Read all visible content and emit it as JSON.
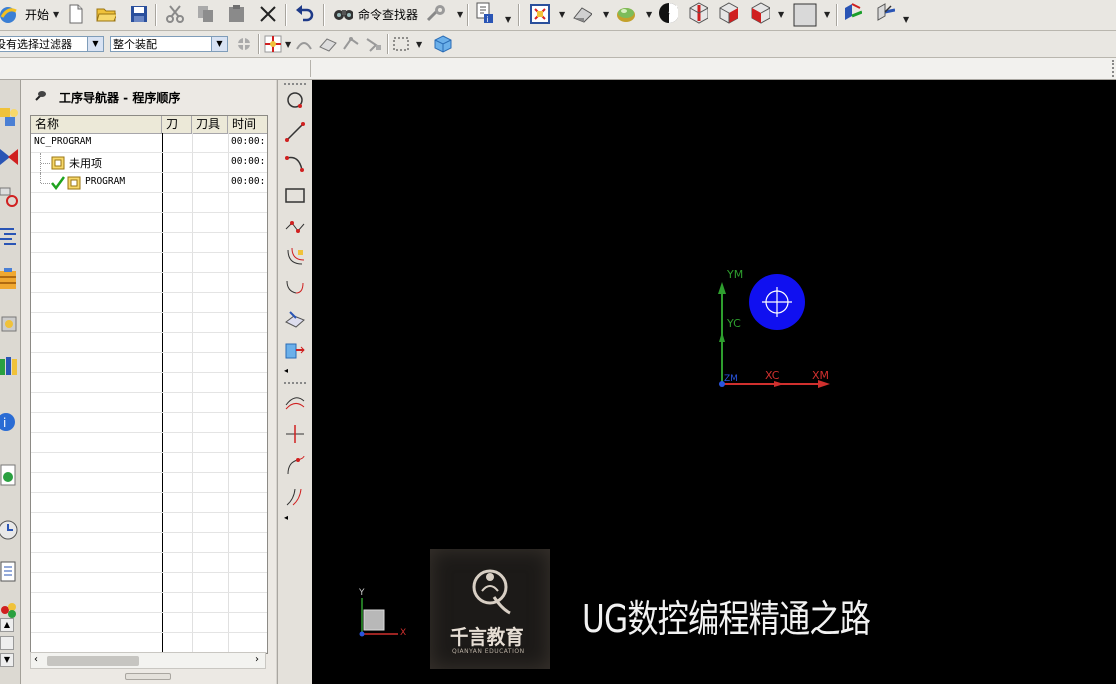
{
  "toolbar": {
    "start_label": "开始",
    "command_finder_label": "命令查找器"
  },
  "filter_bar": {
    "selection_filter_value": "没有选择过滤器",
    "assembly_scope_value": "整个装配"
  },
  "navigator": {
    "title": "工序导航器 - 程序顺序",
    "columns": [
      "名称",
      "刀",
      "刀具",
      "时间"
    ],
    "rows": [
      {
        "name": "NC_PROGRAM",
        "time": "00:00:"
      },
      {
        "name": "未用项",
        "time": "00:00:"
      },
      {
        "name": "PROGRAM",
        "time": "00:00:"
      }
    ]
  },
  "viewport": {
    "axis_labels": {
      "ym": "YM",
      "yc": "YC",
      "xc": "XC",
      "xm": "XM",
      "zm": "ZM"
    },
    "triad_labels": {
      "y": "Y",
      "x": "X"
    },
    "logo": {
      "text_cn": "千言教育",
      "text_en": "QIANYAN EDUCATION"
    },
    "slogan": "UG数控编程精通之路"
  },
  "colors": {
    "viewport_bg": "#000000",
    "ym_axis": "#2e9e2e",
    "xm_axis": "#d0302e",
    "wcs_disc": "#1010f0",
    "check_green": "#1fa31f"
  }
}
